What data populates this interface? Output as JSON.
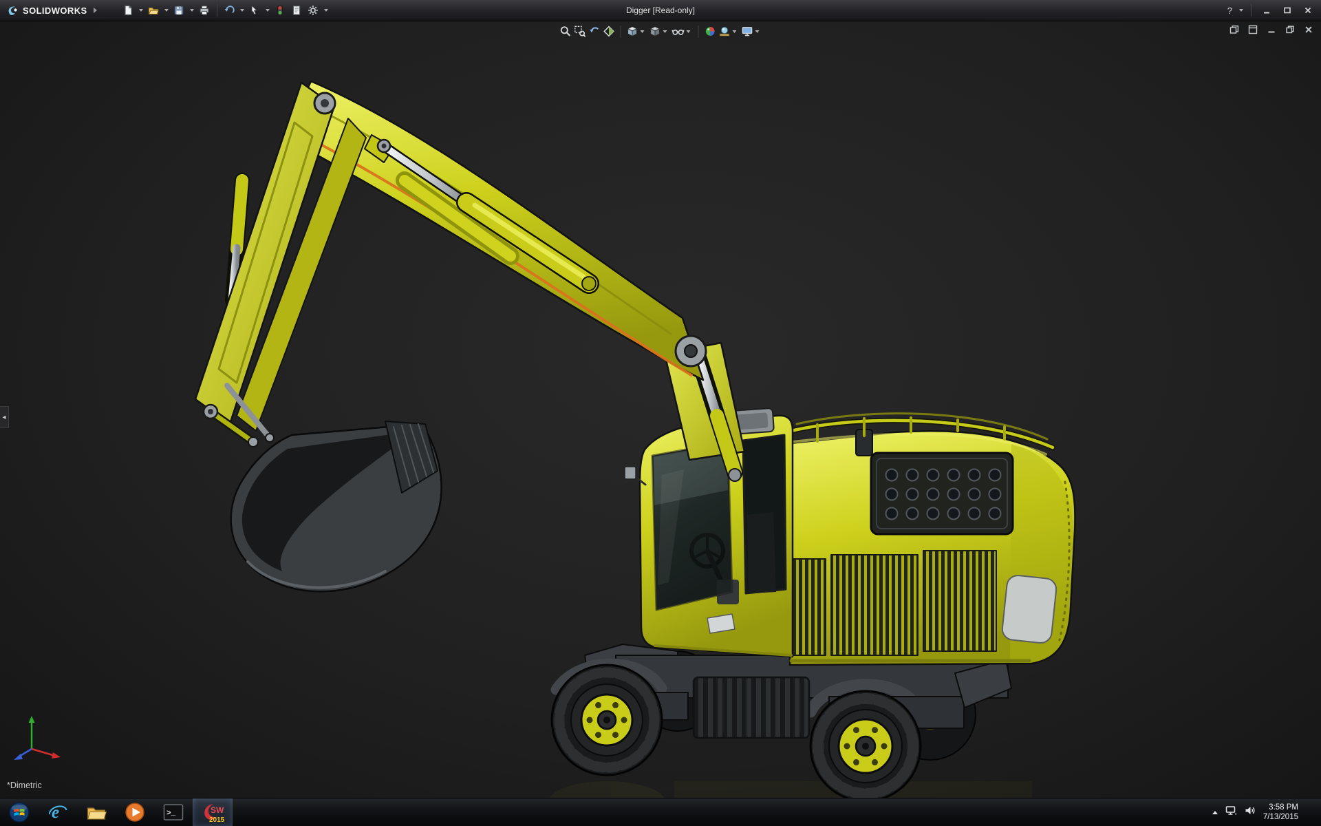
{
  "titlebar": {
    "brand": "SOLIDWORKS",
    "title": "Digger [Read-only]",
    "help": "?",
    "toolbar_icons": [
      "new-document",
      "open",
      "save",
      "print",
      "undo",
      "select-cursor",
      "rebuild",
      "file-properties",
      "options"
    ]
  },
  "headsup_toolbar": {
    "icons": [
      "zoom-to-fit",
      "zoom-to-area",
      "previous-view",
      "section-view",
      "view-orientation",
      "display-style",
      "hide-show-items",
      "edit-appearance",
      "apply-scene",
      "view-settings"
    ]
  },
  "document_controls": [
    "cascade-window",
    "tile-window",
    "minimize-document",
    "restore-document",
    "close-document"
  ],
  "viewport": {
    "orientation": "*Dimetric",
    "model": "Yellow wheeled excavator (Digger) 3D assembly",
    "triad_axes": [
      "x-red",
      "y-green",
      "z-blue"
    ]
  },
  "panel": {
    "collapse_arrow": "◂"
  },
  "glyphs": {
    "ie": "e",
    "prompt": ">_",
    "sw": "SW"
  },
  "taskbar": {
    "items": [
      "start",
      "internet-explorer",
      "file-explorer",
      "media-player",
      "command-prompt",
      "solidworks-2015"
    ],
    "active_item": "solidworks-2015",
    "sw_year": "2015",
    "tray_icons": [
      "hidden-icons",
      "network",
      "volume"
    ],
    "tray": {
      "time": "3:58 PM",
      "date": "7/13/2015"
    }
  },
  "colors": {
    "excavator_yellow": "#cdd11c",
    "viewport_bg": "#1e1e1e",
    "titlebar_bg": "#26262a",
    "taskbar_bg": "#0b0d0f",
    "sw_red": "#d2333b"
  }
}
